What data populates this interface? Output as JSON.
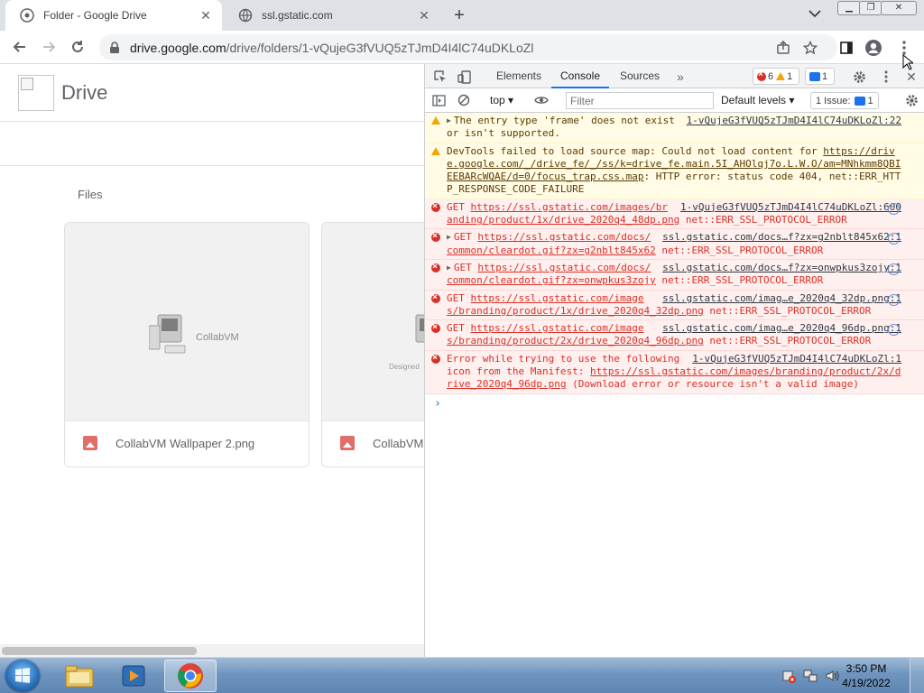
{
  "browser": {
    "tabs": [
      {
        "title": "Folder - Google Drive",
        "active": true
      },
      {
        "title": "ssl.gstatic.com",
        "active": false
      }
    ],
    "url_main": "drive.google.com",
    "url_path": "/drive/folders/1-vQujeG3fVUQ5zTJmD4I4lC74uDKLoZl"
  },
  "drive": {
    "title": "Drive",
    "files_label": "Files",
    "thumb_text": "CollabVM",
    "designed_text": "Designed",
    "files": [
      {
        "name": "CollabVM Wallpaper 2.png"
      },
      {
        "name": "CollabVM"
      }
    ]
  },
  "devtools": {
    "tabs": [
      "Elements",
      "Console",
      "Sources"
    ],
    "active_tab": "Console",
    "error_count": "6",
    "warning_count": "1",
    "message_count": "1",
    "context": "top",
    "filter_placeholder": "Filter",
    "levels": "Default levels",
    "issues_label": "1 Issue:",
    "issues_count": "1",
    "messages": [
      {
        "level": "warn",
        "expandable": true,
        "text": "The entry type 'frame' does not exist or isn't supported.",
        "source": "1-vQujeG3fVUQ5zTJmD4I4lC74uDKLoZl:22"
      },
      {
        "level": "warn",
        "expandable": false,
        "prefix": "DevTools failed to load source map: Could not load content for ",
        "url": "https://drive.google.com/_/drive_fe/_/ss/k=drive_fe.main.5I_AHOlqj7o.L.W.O/am=MNhkmm8QBIEEBARcWQAE/d=0/focus_trap.css.map",
        "suffix": ": HTTP error: status code 404, net::ERR_HTTP_RESPONSE_CODE_FAILURE",
        "source": ""
      },
      {
        "level": "error",
        "expandable": false,
        "prefix": "GET ",
        "url": "https://ssl.gstatic.com/images/branding/product/1x/drive_2020q4_48dp.png",
        "suffix": " net::ERR_SSL_PROTOCOL_ERROR",
        "source": "1-vQujeG3fVUQ5zTJmD4I4lC74uDKLoZl:600"
      },
      {
        "level": "error",
        "expandable": true,
        "prefix": "GET ",
        "url": "https://ssl.gstatic.com/docs/common/cleardot.gif?zx=g2nblt845x62",
        "suffix": " net::ERR_SSL_PROTOCOL_ERROR",
        "source": "ssl.gstatic.com/docs…f?zx=g2nblt845x62:1"
      },
      {
        "level": "error",
        "expandable": true,
        "prefix": "GET ",
        "url": "https://ssl.gstatic.com/docs/common/cleardot.gif?zx=onwpkus3zojy",
        "suffix": " net::ERR_SSL_PROTOCOL_ERROR",
        "source": "ssl.gstatic.com/docs…f?zx=onwpkus3zojy:1"
      },
      {
        "level": "error",
        "expandable": false,
        "prefix": "GET ",
        "url": "https://ssl.gstatic.com/images/branding/product/1x/drive_2020q4_32dp.png",
        "suffix": " net::ERR_SSL_PROTOCOL_ERROR",
        "source": "ssl.gstatic.com/imag…e_2020q4_32dp.png:1"
      },
      {
        "level": "error",
        "expandable": false,
        "prefix": "GET ",
        "url": "https://ssl.gstatic.com/images/branding/product/2x/drive_2020q4_96dp.png",
        "suffix": " net::ERR_SSL_PROTOCOL_ERROR",
        "source": "ssl.gstatic.com/imag…e_2020q4_96dp.png:1"
      },
      {
        "level": "error",
        "expandable": false,
        "prefix": "Error while trying to use the following icon from the Manifest: ",
        "url": "https://ssl.gstatic.com/images/branding/product/2x/drive_2020q4_96dp.png",
        "suffix": " (Download error or resource isn't a valid image)",
        "source": "1-vQujeG3fVUQ5zTJmD4I4lC74uDKLoZl:1"
      }
    ]
  },
  "taskbar": {
    "time": "3:50 PM",
    "date": "4/19/2022"
  }
}
